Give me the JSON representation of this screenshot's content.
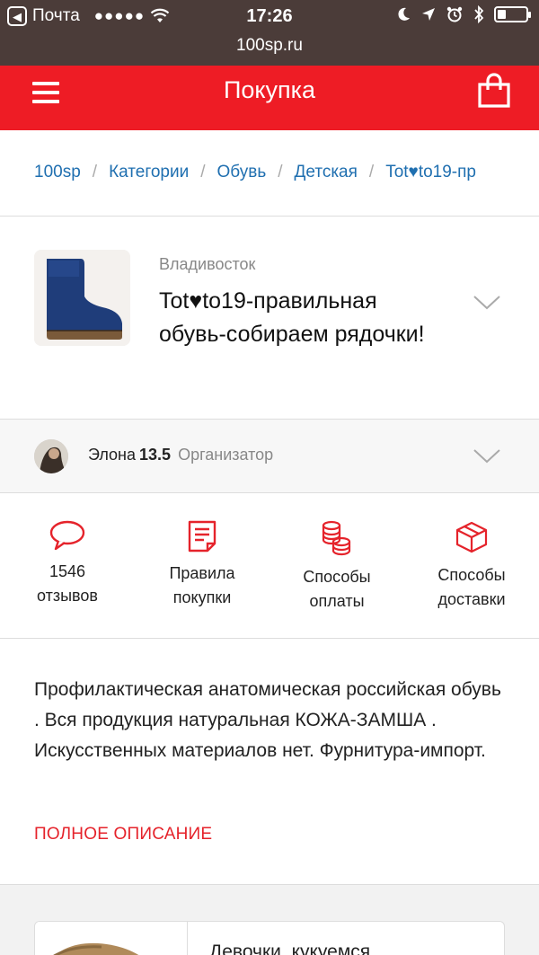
{
  "status_bar": {
    "back_app": "Почта",
    "signal": "●●●●●",
    "time": "17:26",
    "battery_level": 0.3
  },
  "url": "100sp.ru",
  "header": {
    "title": "Покупка"
  },
  "breadcrumbs": [
    "100sp",
    "Категории",
    "Обувь",
    "Детская",
    "Tot♥to19-пр"
  ],
  "product": {
    "city": "Владивосток",
    "title": "Tot♥to19-правильная обувь-собираем рядочки!"
  },
  "organizer": {
    "name": "Элона",
    "rating": "13.5",
    "role": "Организатор"
  },
  "actions": [
    {
      "line1": "1546",
      "line2": "отзывов",
      "icon": "speech-bubble-icon"
    },
    {
      "line1": "Правила",
      "line2": "покупки",
      "icon": "document-icon"
    },
    {
      "line1": "Способы",
      "line2": "оплаты",
      "icon": "coins-icon"
    },
    {
      "line1": "Способы",
      "line2": "доставки",
      "icon": "box-icon"
    }
  ],
  "description": {
    "text": "Профилактическая анатомическая российская обувь . Вся продукция натуральная КОЖА-ЗАМША . Искусственных материалов нет. Фурнитура-импорт.",
    "more_label": "ПОЛНОЕ ОПИСАНИЕ"
  },
  "next_card": {
    "title": "Девочки, кукуемся"
  },
  "colors": {
    "accent_red": "#ee1c25",
    "link_blue": "#1f6fb0",
    "status_bar_bg": "#4b3c39"
  }
}
